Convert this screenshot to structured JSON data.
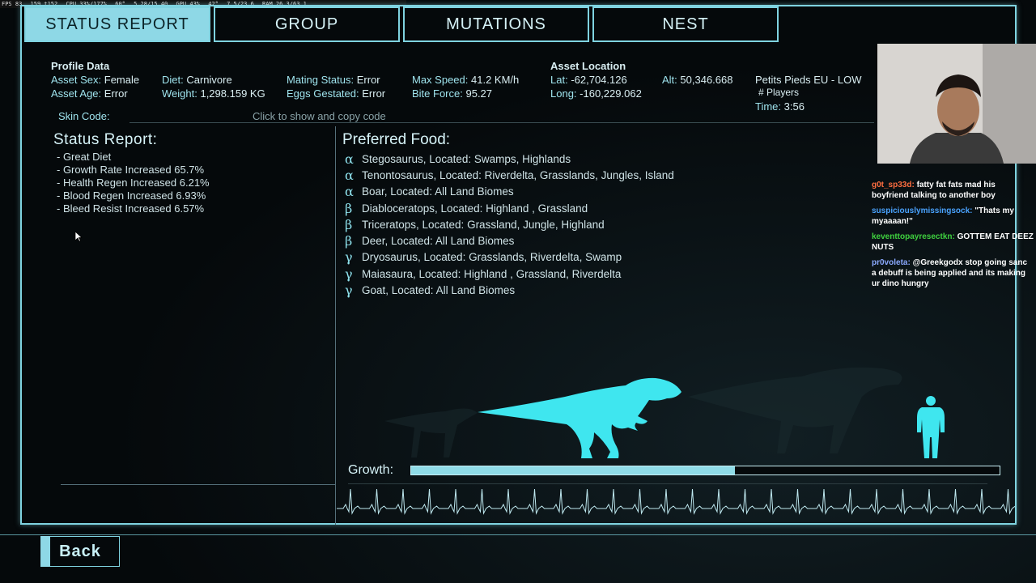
{
  "overlay": {
    "fps": "FPS 83",
    "frametime": "159 t152",
    "cpu": "CPU 33%/177%",
    "cpu_temp": "60°",
    "cpu_clock": "5.28/15.40",
    "gpu": "GPU 43%",
    "gpu_temp": "42°",
    "gpu_mem": "7.5/23.6",
    "ram": "RAM 26.3/63.1"
  },
  "tabs": [
    {
      "label": "STATUS REPORT",
      "active": true
    },
    {
      "label": "GROUP",
      "active": false
    },
    {
      "label": "MUTATIONS",
      "active": false
    },
    {
      "label": "NEST",
      "active": false
    }
  ],
  "profile": {
    "header": "Profile Data",
    "sex_label": "Asset Sex:",
    "sex": "Female",
    "age_label": "Asset Age:",
    "age": "Error",
    "diet_label": "Diet:",
    "diet": "Carnivore",
    "weight_label": "Weight:",
    "weight": "1,298.159  KG",
    "mating_label": "Mating Status:",
    "mating": "Error",
    "eggs_label": "Eggs Gestated:",
    "eggs": "Error",
    "speed_label": "Max Speed:",
    "speed": "41.2  KM/h",
    "bite_label": "Bite Force:",
    "bite": "95.27"
  },
  "location": {
    "header": "Asset Location",
    "lat_label": "Lat:",
    "lat": "-62,704.126",
    "long_label": "Long:",
    "long": "-160,229.062",
    "alt_label": "Alt:",
    "alt": "50,346.668"
  },
  "server": {
    "name": "Petits Pieds EU - LOW",
    "players": "# Players",
    "time_label": "Time:",
    "time": "3:56"
  },
  "skin": {
    "label": "Skin Code:",
    "action": "Click to show and copy code"
  },
  "status_report": {
    "title": "Status  Report:",
    "items": [
      "- Great Diet",
      "- Growth Rate Increased 65.7%",
      "- Health Regen Increased 6.21%",
      "- Blood Regen Increased 6.93%",
      "- Bleed Resist Increased 6.57%"
    ]
  },
  "preferred_food": {
    "title": "Preferred Food:",
    "items": [
      {
        "tier": "α",
        "text": "Stegosaurus, Located: Swamps, Highlands"
      },
      {
        "tier": "α",
        "text": "Tenontosaurus, Located: Riverdelta, Grasslands, Jungles, Island"
      },
      {
        "tier": "α",
        "text": "Boar, Located: All Land Biomes"
      },
      {
        "tier": "β",
        "text": "Diabloceratops, Located: Highland , Grassland"
      },
      {
        "tier": "β",
        "text": "Triceratops, Located: Grassland, Jungle, Highland"
      },
      {
        "tier": "β",
        "text": "Deer, Located: All Land Biomes"
      },
      {
        "tier": "γ",
        "text": "Dryosaurus, Located: Grasslands, Riverdelta, Swamp"
      },
      {
        "tier": "γ",
        "text": "Maiasaura, Located: Highland , Grassland, Riverdelta"
      },
      {
        "tier": "γ",
        "text": "Goat, Located: All Land Biomes"
      }
    ]
  },
  "growth": {
    "label": "Growth:",
    "fraction": 0.55
  },
  "back": {
    "label": "Back"
  },
  "chat": [
    {
      "user": "g0t_sp33d:",
      "text": "fatty fat fats mad his boyfriend talking to another boy"
    },
    {
      "user": "suspiciouslymissingsock:",
      "text": "\"Thats my myaaaan!\""
    },
    {
      "user": "keventtopayresectkn:",
      "text": "GOTTEM EAT DEEZ NUTS"
    },
    {
      "user": "pr0voleta:",
      "text": "@Greekgodx stop going sanc a debuff is being applied and its making ur dino hungry"
    }
  ],
  "colors": {
    "accent": "#7fd3e0",
    "fill": "#8fdbe7",
    "dino": "#3fe6ef"
  }
}
